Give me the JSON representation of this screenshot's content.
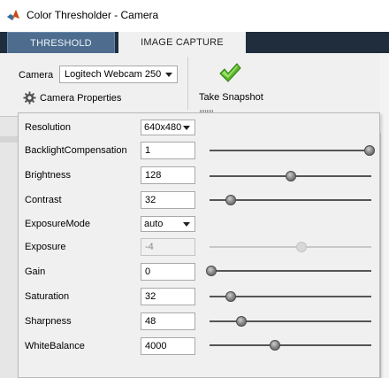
{
  "window": {
    "title": "Color Thresholder - Camera"
  },
  "tabs": [
    {
      "label": "THRESHOLD",
      "selected": false
    },
    {
      "label": "IMAGE CAPTURE",
      "selected": true
    }
  ],
  "toolstrip": {
    "camera_label": "Camera",
    "camera_value": "Logitech Webcam 250",
    "camera_properties_label": "Camera Properties",
    "take_snapshot_label": "Take Snapshot"
  },
  "properties": {
    "resolution": {
      "label": "Resolution",
      "value": "640x480"
    },
    "backlight": {
      "label": "BacklightCompensation",
      "value": "1",
      "level": 1.0
    },
    "brightness": {
      "label": "Brightness",
      "value": "128",
      "level": 0.5
    },
    "contrast": {
      "label": "Contrast",
      "value": "32",
      "level": 0.125
    },
    "exposure_mode": {
      "label": "ExposureMode",
      "value": "auto"
    },
    "exposure": {
      "label": "Exposure",
      "value": "-4",
      "level": 0.57,
      "disabled": true
    },
    "gain": {
      "label": "Gain",
      "value": "0",
      "level": 0.0
    },
    "saturation": {
      "label": "Saturation",
      "value": "32",
      "level": 0.125
    },
    "sharpness": {
      "label": "Sharpness",
      "value": "48",
      "level": 0.19
    },
    "white_balance": {
      "label": "WhiteBalance",
      "value": "4000",
      "level": 0.4
    }
  },
  "colors": {
    "tabstrip": "#1f2d3d",
    "tab_inactive": "#4d6c8e",
    "check": "#5bb82a"
  },
  "icons": {
    "app": "matlab-logo-icon",
    "properties": "gear-icon",
    "snapshot": "checkmark-icon",
    "dropdown": "chevron-down-icon"
  }
}
